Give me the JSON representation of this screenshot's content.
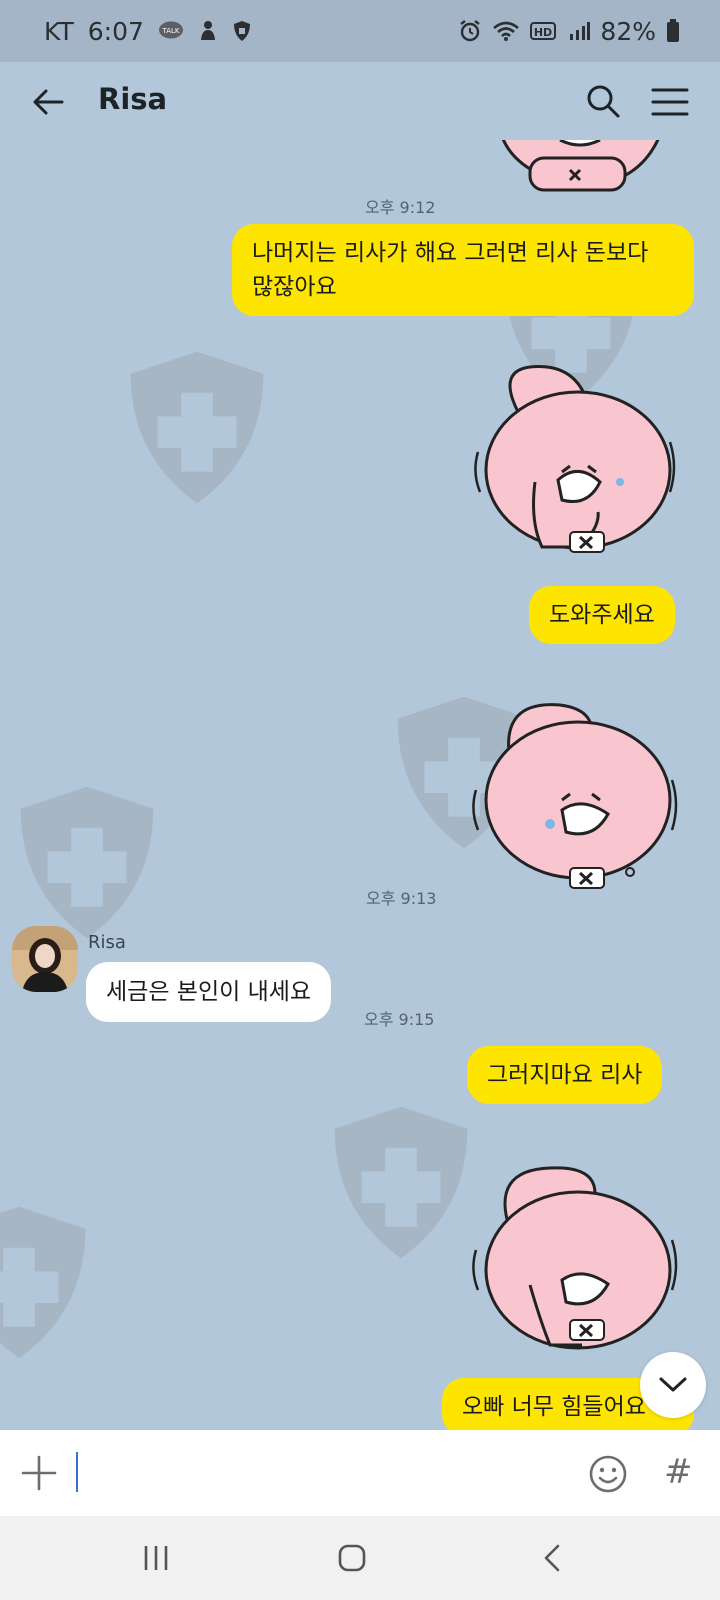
{
  "status_bar": {
    "carrier": "KT",
    "time": "6:07",
    "talk_badge": "TALK",
    "network": "HD",
    "battery": "82%"
  },
  "header": {
    "title": "Risa"
  },
  "messages": {
    "time_1": "오후 9:12",
    "msg_1": "나머지는 리사가 해요 그러면 리사 돈보다 많잖아요",
    "msg_2": "도와주세요",
    "time_2": "오후 9:13",
    "sender": "Risa",
    "msg_3": "세금은 본인이 내세요",
    "time_3": "오후 9:15",
    "msg_4": "그러지마요  리사",
    "msg_5_partial": "오빠 너무 힘들어요"
  },
  "input": {
    "placeholder": ""
  },
  "colors": {
    "chat_bg": "#b2c7da",
    "my_bubble": "#fee500",
    "other_bubble": "#ffffff",
    "sticker_pink": "#f9c6d0"
  }
}
